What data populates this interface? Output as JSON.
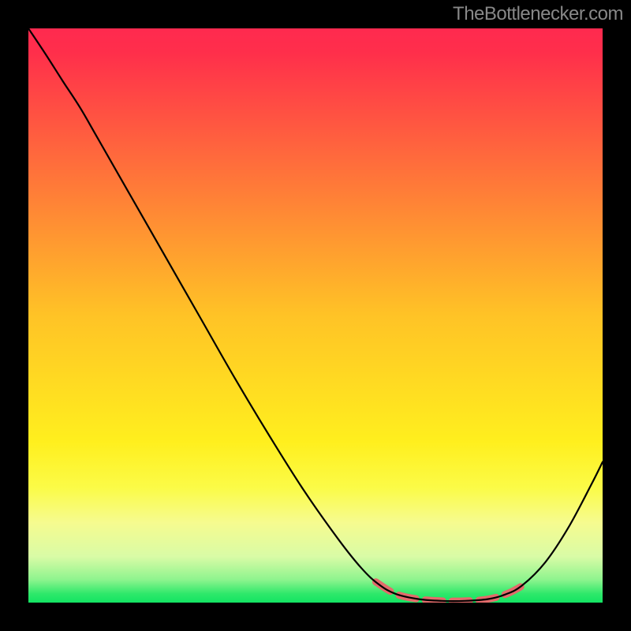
{
  "watermark": "TheBottlenecker.com",
  "chart_data": {
    "type": "line",
    "title": "",
    "xlabel": "",
    "ylabel": "",
    "xlim": [
      0,
      100
    ],
    "ylim": [
      0,
      100
    ],
    "gradient_stops": [
      {
        "offset": 0.0,
        "color": "#ff2a4f"
      },
      {
        "offset": 0.04,
        "color": "#ff2e4b"
      },
      {
        "offset": 0.5,
        "color": "#ffc326"
      },
      {
        "offset": 0.72,
        "color": "#ffef1e"
      },
      {
        "offset": 0.8,
        "color": "#fbfb47"
      },
      {
        "offset": 0.86,
        "color": "#f6fb8f"
      },
      {
        "offset": 0.92,
        "color": "#d9fba6"
      },
      {
        "offset": 0.96,
        "color": "#8ef48e"
      },
      {
        "offset": 0.985,
        "color": "#2de86a"
      },
      {
        "offset": 1.0,
        "color": "#13e463"
      }
    ],
    "series": [
      {
        "name": "bottleneck-curve",
        "color": "#000000",
        "stroke_width": 2.2,
        "points_xy": [
          [
            0.0,
            100.0
          ],
          [
            3.0,
            95.5
          ],
          [
            6.0,
            90.8
          ],
          [
            9.0,
            86.2
          ],
          [
            12.0,
            81.0
          ],
          [
            18.0,
            70.5
          ],
          [
            24.0,
            60.0
          ],
          [
            30.0,
            49.5
          ],
          [
            36.0,
            39.0
          ],
          [
            42.0,
            29.0
          ],
          [
            48.0,
            19.5
          ],
          [
            54.0,
            11.0
          ],
          [
            58.0,
            6.0
          ],
          [
            61.0,
            3.2
          ],
          [
            64.0,
            1.5
          ],
          [
            68.0,
            0.6
          ],
          [
            72.0,
            0.3
          ],
          [
            76.0,
            0.3
          ],
          [
            80.0,
            0.6
          ],
          [
            83.0,
            1.4
          ],
          [
            86.0,
            3.0
          ],
          [
            90.0,
            7.0
          ],
          [
            94.0,
            13.0
          ],
          [
            98.0,
            20.5
          ],
          [
            100.0,
            24.5
          ]
        ]
      },
      {
        "name": "highlight-segment",
        "color": "#e36b6b",
        "stroke_width": 9,
        "dash": [
          22,
          12
        ],
        "points_xy": [
          [
            60.5,
            3.6
          ],
          [
            64.0,
            1.5
          ],
          [
            68.0,
            0.6
          ],
          [
            72.0,
            0.3
          ],
          [
            76.0,
            0.3
          ],
          [
            80.0,
            0.6
          ],
          [
            83.5,
            1.6
          ],
          [
            86.5,
            3.2
          ]
        ]
      }
    ]
  }
}
